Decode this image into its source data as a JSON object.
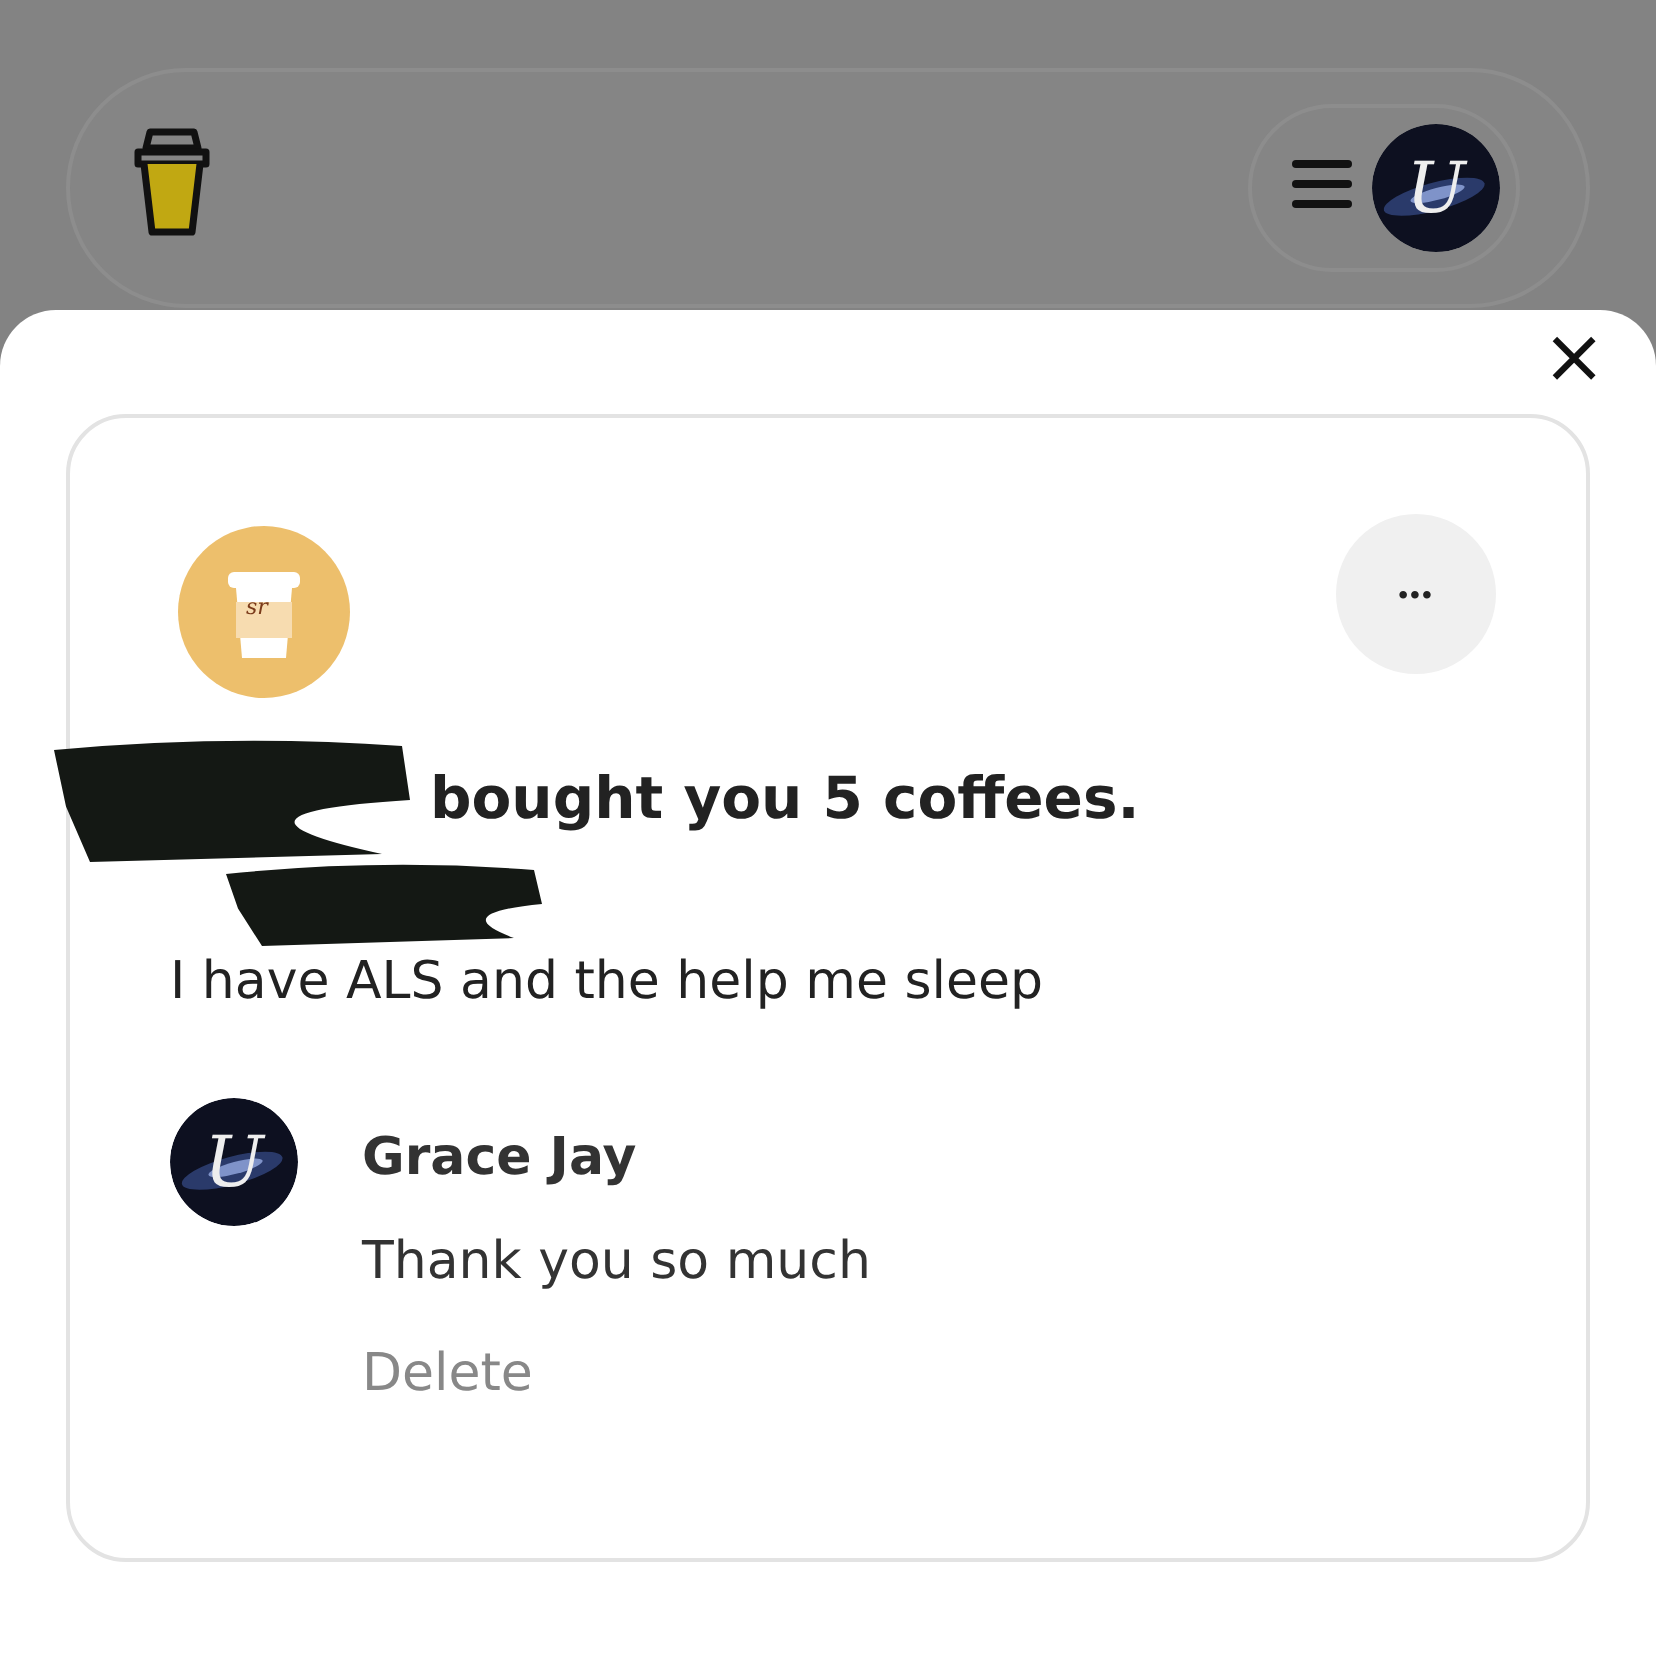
{
  "header": {
    "logo": {
      "kind": "cup"
    },
    "menu": {
      "kind": "hamburger"
    },
    "avatar": {
      "initial": "U"
    }
  },
  "sheet": {
    "close": "×"
  },
  "support": {
    "avatar": {
      "initials": "sr"
    },
    "more": "•••",
    "headline": "bought you 5 coffees.",
    "handle": {
      "redacted": true
    },
    "date": {
      "redacted": true
    },
    "message": "I have ALS and the help me sleep",
    "reply": {
      "avatar": {
        "initial": "U"
      },
      "name": "Grace Jay",
      "text": "Thank you so much",
      "action": "Delete"
    }
  }
}
